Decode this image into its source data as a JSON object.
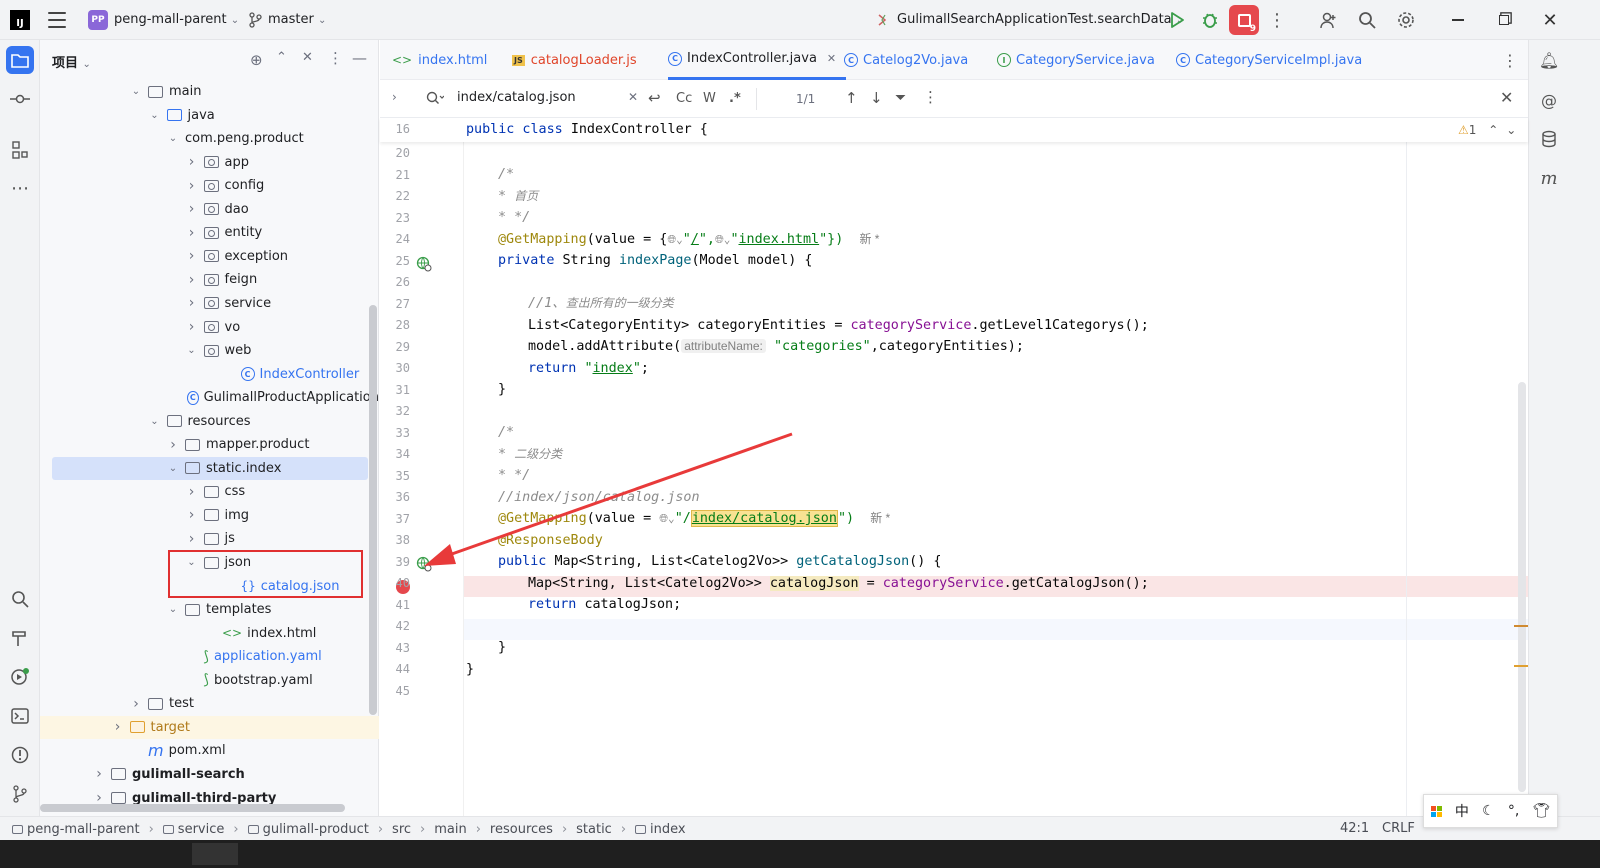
{
  "titlebar": {
    "project_badge": "PP",
    "project_name": "peng-mall-parent",
    "branch": "master",
    "run_config": "GulimallSearchApplicationTest.searchData",
    "notif_count": "9"
  },
  "project_panel": {
    "title": "项目",
    "tree": [
      {
        "label": "main",
        "level": 0,
        "kind": "folder",
        "open": true
      },
      {
        "label": "java",
        "level": 1,
        "kind": "folder-blue",
        "open": true
      },
      {
        "label": "com.peng.product",
        "level": 2,
        "kind": "none",
        "open": true
      },
      {
        "label": "app",
        "level": 3,
        "kind": "pkg",
        "open": false
      },
      {
        "label": "config",
        "level": 3,
        "kind": "pkg",
        "open": false
      },
      {
        "label": "dao",
        "level": 3,
        "kind": "pkg",
        "open": false
      },
      {
        "label": "entity",
        "level": 3,
        "kind": "pkg",
        "open": false
      },
      {
        "label": "exception",
        "level": 3,
        "kind": "pkg",
        "open": false
      },
      {
        "label": "feign",
        "level": 3,
        "kind": "pkg",
        "open": false
      },
      {
        "label": "service",
        "level": 3,
        "kind": "pkg",
        "open": false
      },
      {
        "label": "vo",
        "level": 3,
        "kind": "pkg",
        "open": false
      },
      {
        "label": "web",
        "level": 3,
        "kind": "pkg",
        "open": true
      },
      {
        "label": "IndexController",
        "level": 5,
        "kind": "class",
        "leaf": true,
        "blue": true
      },
      {
        "label": "GulimallProductApplication",
        "level": 4,
        "kind": "class-run",
        "leaf": true
      },
      {
        "label": "resources",
        "level": 1,
        "kind": "folder",
        "open": true
      },
      {
        "label": "mapper.product",
        "level": 2,
        "kind": "folder",
        "open": false
      },
      {
        "label": "static.index",
        "level": 2,
        "kind": "folder",
        "open": true,
        "selected": true
      },
      {
        "label": "css",
        "level": 3,
        "kind": "folder",
        "open": false
      },
      {
        "label": "img",
        "level": 3,
        "kind": "folder",
        "open": false
      },
      {
        "label": "js",
        "level": 3,
        "kind": "folder",
        "open": false
      },
      {
        "label": "json",
        "level": 3,
        "kind": "folder",
        "open": true
      },
      {
        "label": "catalog.json",
        "level": 5,
        "kind": "json",
        "leaf": true,
        "blue": true
      },
      {
        "label": "templates",
        "level": 2,
        "kind": "folder",
        "open": true
      },
      {
        "label": "index.html",
        "level": 4,
        "kind": "html",
        "leaf": true
      },
      {
        "label": "application.yaml",
        "level": 3,
        "kind": "yaml",
        "leaf": true,
        "blue": true
      },
      {
        "label": "bootstrap.yaml",
        "level": 3,
        "kind": "yaml",
        "leaf": true
      },
      {
        "label": "test",
        "level": 0,
        "kind": "folder",
        "open": false
      },
      {
        "label": "target",
        "level": -1,
        "kind": "folder-orange",
        "open": false,
        "orange": true
      },
      {
        "label": "pom.xml",
        "level": 0,
        "kind": "maven",
        "leaf": true
      },
      {
        "label": "gulimall-search",
        "level": -2,
        "kind": "module",
        "open": false,
        "bold": true
      },
      {
        "label": "gulimall-third-party",
        "level": -2,
        "kind": "module",
        "open": false,
        "bold": true
      }
    ]
  },
  "tabs": [
    {
      "label": "index.html",
      "icon": "html-icon",
      "active": false
    },
    {
      "label": "catalogLoader.js",
      "icon": "js-icon",
      "active": false
    },
    {
      "label": "IndexController.java",
      "icon": "class-icon",
      "active": true
    },
    {
      "label": "Catelog2Vo.java",
      "icon": "class-icon",
      "active": false
    },
    {
      "label": "CategoryService.java",
      "icon": "interface-icon",
      "active": false
    },
    {
      "label": "CategoryServiceImpl.java",
      "icon": "class-icon",
      "active": false
    }
  ],
  "findbar": {
    "query": "index/catalog.json",
    "case": "Cc",
    "word": "W",
    "regex": ".*",
    "matches": "1/1"
  },
  "editor": {
    "sticky_line": "16",
    "warning_count": "1",
    "line_numbers": [
      "20",
      "21",
      "22",
      "23",
      "24",
      "25",
      "26",
      "27",
      "28",
      "29",
      "30",
      "31",
      "32",
      "33",
      "34",
      "35",
      "36",
      "37",
      "38",
      "39",
      "40",
      "41",
      "42",
      "43",
      "44",
      "45"
    ],
    "code": {
      "sticky": [
        "public class ",
        "IndexController {"
      ],
      "l21": "/*",
      "l22a": "* ",
      "l22b": "首页",
      "l23": "* */",
      "l24a": "@GetMapping",
      "l24b": "(value = {",
      "l24c": "\"",
      "l24d": "/",
      "l24e": "\",",
      "l24f": "\"",
      "l24g": "index.html",
      "l24h": "\"})",
      "l24i": "新 *",
      "l25a": "private ",
      "l25b": "String ",
      "l25c": "indexPage",
      "l25d": "(Model model) {",
      "l27a": "//1、",
      "l27b": "查出所有的一级分类",
      "l28a": "List<CategoryEntity> categoryEntities = ",
      "l28b": "categoryService",
      "l28c": ".getLevel1Categorys();",
      "l29a": "model.addAttribute(",
      "l29b": "attributeName:",
      "l29c": "\"categories\"",
      "l29d": ",categoryEntities);",
      "l30a": "return ",
      "l30b": "\"",
      "l30c": "index",
      "l30d": "\"",
      "l30e": ";",
      "l31": "}",
      "l33": "/*",
      "l34a": "* ",
      "l34b": "二级分类",
      "l35": "* */",
      "l36": "//index/json/catalog.json",
      "l37a": "@GetMapping",
      "l37b": "(value = ",
      "l37c": "\"/",
      "l37d": "index/catalog.json",
      "l37e": "\")",
      "l37f": "新 *",
      "l38": "@ResponseBody",
      "l39a": "public ",
      "l39b": "Map<String, List<Catelog2Vo>> ",
      "l39c": "getCatalogJson",
      "l39d": "() {",
      "l40a": "Map<String, List<Catelog2Vo>> ",
      "l40b": "catalogJson",
      "l40c": " = ",
      "l40d": "categoryService",
      "l40e": ".getCatalogJson();",
      "l41a": "return ",
      "l41b": "catalogJson;",
      "l43": "}",
      "l44": "}"
    }
  },
  "statusbar": {
    "breadcrumbs": [
      "peng-mall-parent",
      "service",
      "gulimall-product",
      "src",
      "main",
      "resources",
      "static",
      "index"
    ],
    "position": "42:1",
    "line_sep": "CRLF"
  },
  "ime": {
    "lang": "中",
    "punct": "°,"
  },
  "colors": {
    "accent": "#3574f0",
    "highlight_box": "#e03030",
    "breakpoint": "#e5484d",
    "arrow": "#e83a3a"
  }
}
